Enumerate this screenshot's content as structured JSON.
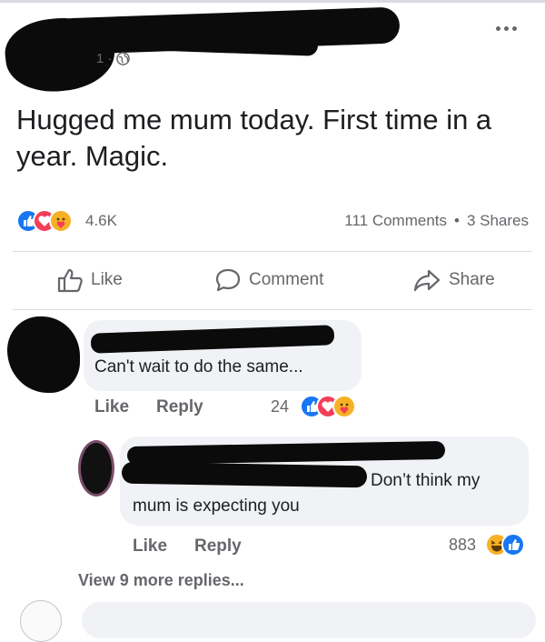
{
  "post": {
    "author_suffix": "1 ·",
    "more_icon": "more-dots-icon",
    "privacy_icon": "globe-icon",
    "text": "Hugged me mum today. First time in a year. Magic.",
    "reaction_count": "4.6K",
    "comments_count": "111 Comments",
    "separator": "•",
    "shares_count": "3 Shares"
  },
  "actions": {
    "like": "Like",
    "comment": "Comment",
    "share": "Share"
  },
  "comment1": {
    "text": "Can't wait to do the same...",
    "like": "Like",
    "reply": "Reply",
    "reaction_count": "24"
  },
  "reply1": {
    "text_line1": "Don’t think my",
    "text_line2": "mum is expecting you",
    "like": "Like",
    "reply": "Reply",
    "reaction_count": "883"
  },
  "view_more": "View 9 more replies...",
  "colors": {
    "like_blue": "#1877f2",
    "love_red": "#f33e58",
    "care_yellow": "#f7b125",
    "muted": "#65676b",
    "bubble": "#f0f2f5"
  }
}
